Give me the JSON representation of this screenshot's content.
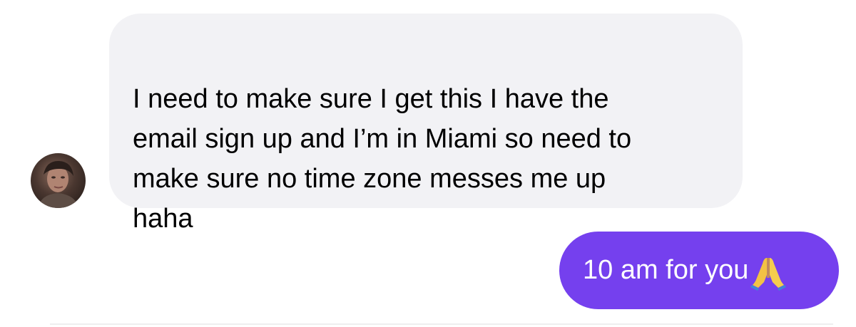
{
  "conversation": {
    "messages": [
      {
        "direction": "incoming",
        "text": "I need to make sure I get this I have the\nemail sign up and I’m in Miami so need to\nmake sure no time zone messes me up\nhaha"
      },
      {
        "direction": "outgoing",
        "text": "10 am for you",
        "emoji": "folded-hands-icon"
      }
    ]
  },
  "colors": {
    "incoming_bubble": "#f2f2f5",
    "outgoing_bubble": "#7540ee",
    "incoming_text": "#000000",
    "outgoing_text": "#ffffff"
  }
}
